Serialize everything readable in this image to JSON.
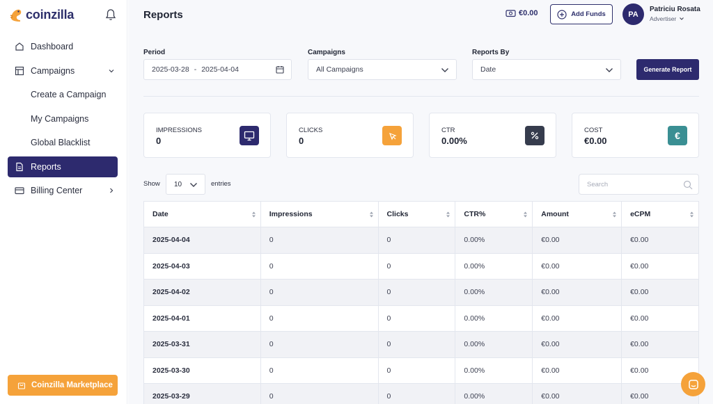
{
  "brand": {
    "name": "coinzilla",
    "color": "#2d2f6b",
    "accent": "#f5a23a"
  },
  "sidebar": {
    "items": [
      {
        "label": "Dashboard",
        "icon": "home-icon"
      },
      {
        "label": "Campaigns",
        "icon": "layout-icon"
      },
      {
        "label": "Create a Campaign"
      },
      {
        "label": "My Campaigns"
      },
      {
        "label": "Global Blacklist"
      },
      {
        "label": "Reports",
        "icon": "document-icon",
        "active": true
      },
      {
        "label": "Billing Center",
        "icon": "credit-card-icon"
      }
    ],
    "marketplace_label": "Coinzilla Marketplace"
  },
  "header": {
    "title": "Reports",
    "balance": "€0.00",
    "add_funds_label": "Add Funds",
    "user": {
      "initials": "PA",
      "name": "Patriciu Rosata",
      "role": "Advertiser"
    }
  },
  "filters": {
    "period_label": "Period",
    "period_start": "2025-03-28",
    "period_sep": "-",
    "period_end": "2025-04-04",
    "campaigns_label": "Campaigns",
    "campaigns_value": "All Campaigns",
    "reports_by_label": "Reports By",
    "reports_by_value": "Date",
    "generate_label": "Generate Report"
  },
  "stats": [
    {
      "label": "IMPRESSIONS",
      "value": "0",
      "icon": "monitor-icon",
      "color": "#2d2a6e"
    },
    {
      "label": "CLICKS",
      "value": "0",
      "icon": "cursor-click-icon",
      "color": "#f5a23a"
    },
    {
      "label": "CTR",
      "value": "0.00%",
      "icon": "percent-icon",
      "color": "#363c4d"
    },
    {
      "label": "COST",
      "value": "€0.00",
      "icon": "euro-icon",
      "color": "#3a8f93"
    }
  ],
  "table_controls": {
    "show_label": "Show",
    "entries_value": "10",
    "entries_label": "entries",
    "search_placeholder": "Search"
  },
  "table": {
    "columns": [
      "Date",
      "Impressions",
      "Clicks",
      "CTR%",
      "Amount",
      "eCPM"
    ],
    "rows": [
      [
        "2025-04-04",
        "0",
        "0",
        "0.00%",
        "€0.00",
        "€0.00"
      ],
      [
        "2025-04-03",
        "0",
        "0",
        "0.00%",
        "€0.00",
        "€0.00"
      ],
      [
        "2025-04-02",
        "0",
        "0",
        "0.00%",
        "€0.00",
        "€0.00"
      ],
      [
        "2025-04-01",
        "0",
        "0",
        "0.00%",
        "€0.00",
        "€0.00"
      ],
      [
        "2025-03-31",
        "0",
        "0",
        "0.00%",
        "€0.00",
        "€0.00"
      ],
      [
        "2025-03-30",
        "0",
        "0",
        "0.00%",
        "€0.00",
        "€0.00"
      ],
      [
        "2025-03-29",
        "0",
        "0",
        "0.00%",
        "€0.00",
        "€0.00"
      ]
    ]
  }
}
